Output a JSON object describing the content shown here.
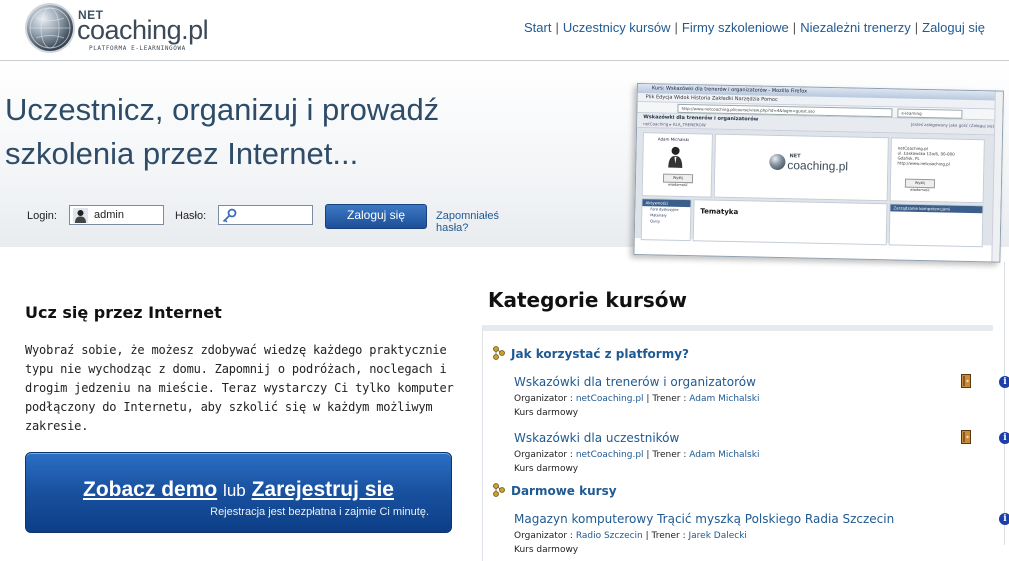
{
  "logo": {
    "net": "NET",
    "main": "coaching.pl",
    "sub": "PLATFORMA E-LEARNINGOWA"
  },
  "nav": {
    "items": [
      "Start",
      "Uczestnicy kursów",
      "Firmy szkoleniowe",
      "Niezależni trenerzy",
      "Zaloguj się"
    ],
    "separator": "|"
  },
  "hero": {
    "title_line1": "Uczestnicz, organizuj i prowadź",
    "title_line2": "szkolenia przez Internet...",
    "login_label": "Login:",
    "login_value": "admin",
    "password_label": "Hasło:",
    "password_value": "",
    "login_button": "Zaloguj się",
    "forgot_link": "Zapomniałeś hasła?"
  },
  "screenshot_mock": {
    "window_title": "Kurs: Wskazówki dla trenerów i organizatorów - Mozilla Firefox",
    "menu": "Plik  Edycja  Widok  Historia  Zakładki  Narzędzia  Pomoc",
    "url": "http://www.netcoaching.pl/course/view.php?id=4&login=guest.sso",
    "search": "e-learning",
    "page_title": "Wskazówki dla trenerów i organizatorów",
    "crumb": "netCoaching  ▸  KLA_TRENEROW",
    "user_line": "Jesteś zalogowany jako gość (Zaloguj się)",
    "person_name": "Adam Michalski",
    "person_button": "Wyślij wiadomość",
    "logo_net": "NET",
    "logo_text": "coaching.pl",
    "address": "netCoaching.pl\nul. Łaskowska 12a/6, 00-000\nGdańsk, PL\nhttp://www.netcoaching.pl",
    "company_button": "Wyślij wiadomość",
    "side_header": "Aktywności",
    "side_items": [
      "Fora dyskusyjne",
      "Materiały",
      "Quizy"
    ],
    "main_heading": "Tematyka",
    "right_header": "Zarządzanie kompetencjami"
  },
  "left": {
    "title": "Ucz się przez Internet",
    "text": "Wyobraź sobie, że możesz zdobywać wiedzę każdego praktycznie typu nie wychodząc z domu. Zapomnij o podróżach, noclegach i drogim jedzeniu na mieście. Teraz wystarczy Ci tylko komputer podłączony do Internetu, aby szkolić się w każdym możliwym zakresie.",
    "cta_demo": "Zobacz demo",
    "cta_or": "lub",
    "cta_register": "Zarejestruj sie",
    "cta_sub": "Rejestracja jest bezpłatna i zajmie Ci minutę."
  },
  "categories": {
    "title": "Kategorie kursów",
    "groups": [
      {
        "name": "Jak korzystać z platformy?",
        "courses": [
          {
            "name": "Wskazówki dla trenerów i organizatorów",
            "org_label": "Organizator :",
            "org": "netCoaching.pl",
            "trainer_label": "Trener :",
            "trainer": "Adam Michalski",
            "free": "Kurs darmowy"
          },
          {
            "name": "Wskazówki dla uczestników",
            "org_label": "Organizator :",
            "org": "netCoaching.pl",
            "trainer_label": "Trener :",
            "trainer": "Adam Michalski",
            "free": "Kurs darmowy"
          }
        ]
      },
      {
        "name": "Darmowe kursy",
        "courses": [
          {
            "name": "Magazyn komputerowy Trącić myszką Polskiego Radia Szczecin",
            "org_label": "Organizator :",
            "org": "Radio Szczecin",
            "trainer_label": "Trener :",
            "trainer": "Jarek Dalecki",
            "free": "Kurs darmowy"
          }
        ]
      }
    ]
  },
  "colors": {
    "link": "#1f5a92",
    "hero_title": "#2e4b68",
    "cta_blue": "#1a53a2",
    "info_icon": "#1d3fa8"
  },
  "icons": {
    "login_field": "user-icon",
    "password_field": "key-icon",
    "category": "category-icon",
    "course_guest": "book-icon",
    "course_info": "info-icon"
  }
}
